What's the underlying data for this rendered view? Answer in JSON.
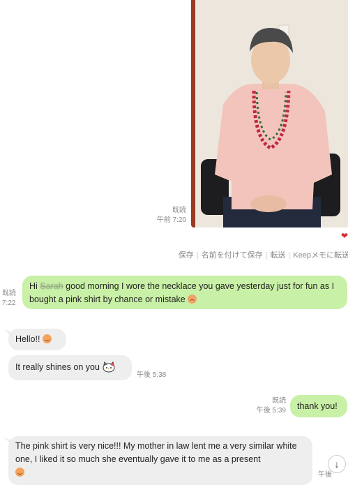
{
  "photo_message": {
    "read_label": "既読",
    "time": "午前 7:20"
  },
  "actions": {
    "items": [
      "保存",
      "名前を付けて保存",
      "転送",
      "Keepメモに転送"
    ]
  },
  "messages": [
    {
      "side": "right",
      "read_label": "既読",
      "time": "7:22",
      "text_prefix": "Hi ",
      "redacted": "Sarah",
      "text_main": " good morning I wore the necklace you gave yesterday just for fun as I bought a pink shirt by chance or mistake"
    },
    {
      "side": "left",
      "text": "Hello!!"
    },
    {
      "side": "left",
      "text": "It really shines on you",
      "time": "午後 5:38"
    },
    {
      "side": "right",
      "read_label": "既読",
      "time": "午後 5:39",
      "text": "thank you!"
    },
    {
      "side": "left",
      "text": "The pink shirt is very nice!!! My mother in law lent me a very similar white one, I liked it so much she eventually gave it to me as a present",
      "time": "午後"
    }
  ],
  "icons": {
    "heart": "heart-icon",
    "smile": "smiling-face-emoji",
    "worried": "worried-face-emoji",
    "kitty": "hello-kitty-sticker-icon",
    "scroll": "scroll-down-arrow-icon"
  },
  "colors": {
    "outgoing_bubble": "#c9f0a7",
    "incoming_bubble": "#eeeeee",
    "meta_text": "#888888"
  }
}
